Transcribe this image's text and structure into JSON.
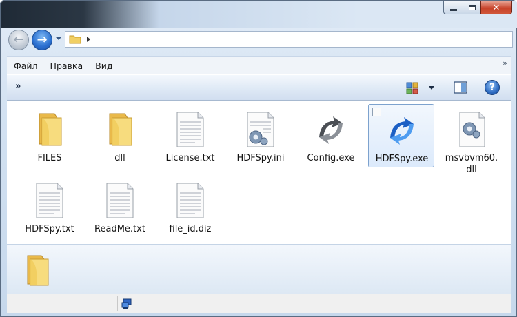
{
  "window": {
    "caption_buttons": {
      "minimize": "minimize-icon",
      "maximize": "maximize-icon",
      "close": "close-icon"
    },
    "close_glyph": "✕"
  },
  "navigation": {
    "back_glyph": "←",
    "forward_glyph": "→",
    "address_breadcrumb_icon": "folder-icon"
  },
  "menu": {
    "items": [
      {
        "label": "Файл"
      },
      {
        "label": "Правка"
      },
      {
        "label": "Вид"
      }
    ],
    "overflow": "»"
  },
  "toolbar": {
    "overflow": "»",
    "help_glyph": "?"
  },
  "files": [
    {
      "name": "FILES",
      "type": "folder"
    },
    {
      "name": "dll",
      "type": "folder"
    },
    {
      "name": "License.txt",
      "type": "text"
    },
    {
      "name": "HDFSpy.ini",
      "type": "config"
    },
    {
      "name": "Config.exe",
      "type": "exe-gray"
    },
    {
      "name": "HDFSpy.exe",
      "type": "exe-blue",
      "selected": true
    },
    {
      "name": "msvbvm60.\ndll",
      "line1": "msvbvm60.",
      "line2": "dll",
      "type": "dll"
    },
    {
      "name": "HDFSpy.txt",
      "type": "text"
    },
    {
      "name": "ReadMe.txt",
      "type": "text"
    },
    {
      "name": "file_id.diz",
      "type": "text"
    }
  ],
  "colors": {
    "selection_border": "#7da2ce",
    "folder": "#f3d36b",
    "accent_blue": "#2a6fd0"
  }
}
